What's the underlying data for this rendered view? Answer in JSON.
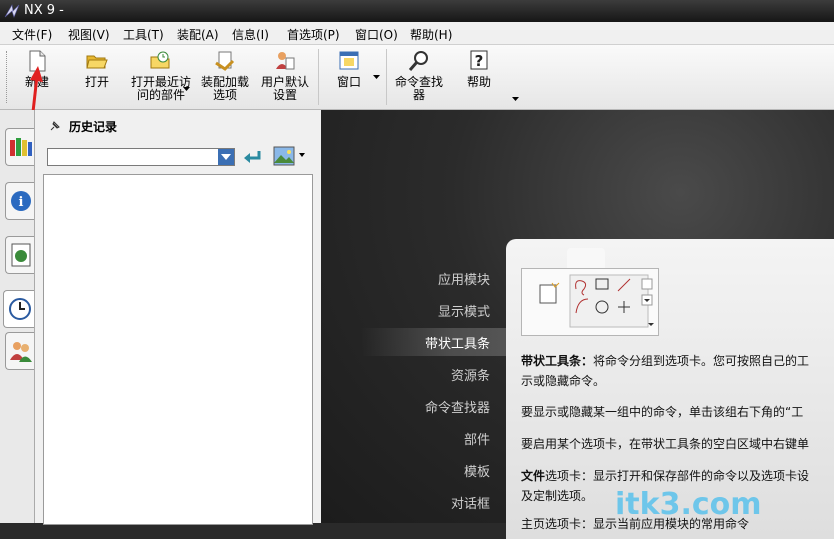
{
  "window": {
    "title": "NX 9 -"
  },
  "menu": {
    "items": [
      {
        "label": "文件(F)"
      },
      {
        "label": "视图(V)"
      },
      {
        "label": "工具(T)"
      },
      {
        "label": "装配(A)"
      },
      {
        "label": "信息(I)"
      },
      {
        "label": "首选项(P)"
      },
      {
        "label": "窗口(O)"
      },
      {
        "label": "帮助(H)"
      }
    ]
  },
  "toolbar": {
    "new": {
      "l1": "新建",
      "l2": ""
    },
    "open": {
      "l1": "打开",
      "l2": ""
    },
    "recent": {
      "l1": "打开最近访",
      "l2": "问的部件"
    },
    "assembly_load": {
      "l1": "装配加载",
      "l2": "选项"
    },
    "user_defaults": {
      "l1": "用户默认",
      "l2": "设置"
    },
    "window": {
      "l1": "窗口",
      "l2": ""
    },
    "command_finder": {
      "l1": "命令查找",
      "l2": "器"
    },
    "help": {
      "l1": "帮助",
      "l2": ""
    }
  },
  "history_panel": {
    "title": "历史记录",
    "combo_value": ""
  },
  "resource_nav": {
    "items": [
      {
        "label": "应用模块"
      },
      {
        "label": "显示模式"
      },
      {
        "label": "带状工具条"
      },
      {
        "label": "资源条"
      },
      {
        "label": "命令查找器"
      },
      {
        "label": "部件"
      },
      {
        "label": "模板"
      },
      {
        "label": "对话框"
      }
    ],
    "active_index": 2
  },
  "info_card": {
    "p1_bold": "带状工具条：",
    "p1_text": "将命令分组到选项卡。您可按照自己的工",
    "p1_line2": "示或隐藏命令。",
    "p2": "要显示或隐藏某一组中的命令，单击该组右下角的“工",
    "p3": "要启用某个选项卡，在带状工具条的空白区域中右键单",
    "p4_bold": "文件",
    "p4_text": "选项卡：显示打开和保存部件的命令以及选项卡设",
    "p4_line2": "及定制选项。",
    "p5": "主页选项卡：显示当前应用模块的常用命令"
  },
  "watermark": "itk3.com",
  "colors": {
    "accent_blue": "#3b6fb4",
    "arrow_red": "#e02020",
    "watermark": "#6ec6ea"
  }
}
